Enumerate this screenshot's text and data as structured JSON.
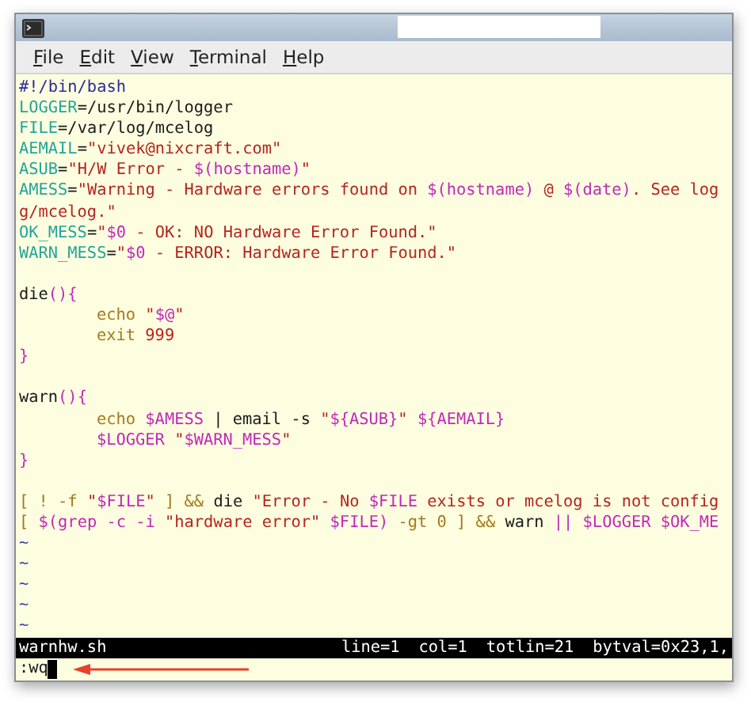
{
  "window": {
    "title_redacted": true
  },
  "menu": [
    {
      "label": "File"
    },
    {
      "label": "Edit"
    },
    {
      "label": "View"
    },
    {
      "label": "Terminal"
    },
    {
      "label": "Help"
    }
  ],
  "lines": [
    {
      "kind": "code",
      "segments": [
        {
          "text": "#!/bin/bash",
          "kind": "shebang"
        }
      ]
    },
    {
      "kind": "code",
      "segments": [
        {
          "text": "LOGGER",
          "kind": "var"
        },
        {
          "text": "=/usr/bin/logger",
          "kind": "plain"
        }
      ]
    },
    {
      "kind": "code",
      "segments": [
        {
          "text": "FILE",
          "kind": "var"
        },
        {
          "text": "=/var/log/mcelog",
          "kind": "plain"
        }
      ]
    },
    {
      "kind": "code",
      "segments": [
        {
          "text": "AEMAIL",
          "kind": "var"
        },
        {
          "text": "=",
          "kind": "plain"
        },
        {
          "text": "\"vivek@nixcraft.com\"",
          "kind": "str"
        }
      ]
    },
    {
      "kind": "code",
      "segments": [
        {
          "text": "ASUB",
          "kind": "var"
        },
        {
          "text": "=",
          "kind": "plain"
        },
        {
          "text": "\"H/W Error - ",
          "kind": "str"
        },
        {
          "text": "$(hostname)",
          "kind": "subst"
        },
        {
          "text": "\"",
          "kind": "str"
        }
      ]
    },
    {
      "kind": "code",
      "segments": [
        {
          "text": "AMESS",
          "kind": "var"
        },
        {
          "text": "=",
          "kind": "plain"
        },
        {
          "text": "\"Warning - Hardware errors found on ",
          "kind": "str"
        },
        {
          "text": "$(hostname)",
          "kind": "subst"
        },
        {
          "text": " @ ",
          "kind": "str"
        },
        {
          "text": "$(date)",
          "kind": "subst"
        },
        {
          "text": ". See log",
          "kind": "str"
        }
      ]
    },
    {
      "kind": "code",
      "segments": [
        {
          "text": "g/mcelog.\"",
          "kind": "str"
        }
      ]
    },
    {
      "kind": "code",
      "segments": [
        {
          "text": "OK_MESS",
          "kind": "var"
        },
        {
          "text": "=",
          "kind": "plain"
        },
        {
          "text": "\"",
          "kind": "str"
        },
        {
          "text": "$0",
          "kind": "subst"
        },
        {
          "text": " - OK: NO Hardware Error Found.\"",
          "kind": "str"
        }
      ]
    },
    {
      "kind": "code",
      "segments": [
        {
          "text": "WARN_MESS",
          "kind": "var"
        },
        {
          "text": "=",
          "kind": "plain"
        },
        {
          "text": "\"",
          "kind": "str"
        },
        {
          "text": "$0",
          "kind": "subst"
        },
        {
          "text": " - ERROR: Hardware Error Found.\"",
          "kind": "str"
        }
      ]
    },
    {
      "kind": "blank"
    },
    {
      "kind": "code",
      "segments": [
        {
          "text": "die",
          "kind": "plain"
        },
        {
          "text": "(){",
          "kind": "punct"
        }
      ]
    },
    {
      "kind": "code",
      "indent": true,
      "segments": [
        {
          "text": "echo ",
          "kind": "builtin"
        },
        {
          "text": "\"",
          "kind": "str"
        },
        {
          "text": "$@",
          "kind": "subst"
        },
        {
          "text": "\"",
          "kind": "str"
        }
      ]
    },
    {
      "kind": "code",
      "indent": true,
      "segments": [
        {
          "text": "exit ",
          "kind": "builtin"
        },
        {
          "text": "999",
          "kind": "num"
        }
      ]
    },
    {
      "kind": "code",
      "segments": [
        {
          "text": "}",
          "kind": "punct"
        }
      ]
    },
    {
      "kind": "blank"
    },
    {
      "kind": "code",
      "segments": [
        {
          "text": "warn",
          "kind": "plain"
        },
        {
          "text": "(){",
          "kind": "punct"
        }
      ]
    },
    {
      "kind": "code",
      "indent": true,
      "segments": [
        {
          "text": "echo ",
          "kind": "builtin"
        },
        {
          "text": "$AMESS",
          "kind": "subst"
        },
        {
          "text": " | email -s ",
          "kind": "plain"
        },
        {
          "text": "\"",
          "kind": "str"
        },
        {
          "text": "${ASUB}",
          "kind": "subst"
        },
        {
          "text": "\" ",
          "kind": "str"
        },
        {
          "text": "${AEMAIL}",
          "kind": "subst"
        }
      ]
    },
    {
      "kind": "code",
      "indent": true,
      "segments": [
        {
          "text": "$LOGGER ",
          "kind": "subst"
        },
        {
          "text": "\"",
          "kind": "str"
        },
        {
          "text": "$WARN_MESS",
          "kind": "subst"
        },
        {
          "text": "\"",
          "kind": "str"
        }
      ]
    },
    {
      "kind": "code",
      "segments": [
        {
          "text": "}",
          "kind": "punct"
        }
      ]
    },
    {
      "kind": "blank"
    },
    {
      "kind": "code",
      "segments": [
        {
          "text": "[ ! -f ",
          "kind": "builtin"
        },
        {
          "text": "\"",
          "kind": "str"
        },
        {
          "text": "$FILE",
          "kind": "subst"
        },
        {
          "text": "\"",
          "kind": "str"
        },
        {
          "text": " ] && ",
          "kind": "builtin"
        },
        {
          "text": "die ",
          "kind": "plain"
        },
        {
          "text": "\"Error - No ",
          "kind": "str"
        },
        {
          "text": "$FILE",
          "kind": "subst"
        },
        {
          "text": " exists or mcelog is not config",
          "kind": "str"
        }
      ]
    },
    {
      "kind": "code",
      "segments": [
        {
          "text": "[ ",
          "kind": "builtin"
        },
        {
          "text": "$(grep -c -i ",
          "kind": "subst"
        },
        {
          "text": "\"hardware error\" ",
          "kind": "str"
        },
        {
          "text": "$FILE",
          "kind": "subst"
        },
        {
          "text": ")",
          "kind": "subst"
        },
        {
          "text": " -gt 0 ] && ",
          "kind": "builtin"
        },
        {
          "text": "warn ",
          "kind": "plain"
        },
        {
          "text": "|| ",
          "kind": "subst"
        },
        {
          "text": "$LOGGER ",
          "kind": "subst"
        },
        {
          "text": "$OK_ME",
          "kind": "subst"
        }
      ]
    }
  ],
  "tilde_lines": [
    "~",
    "~",
    "~",
    "~",
    "~"
  ],
  "status_bar": {
    "filename": "warnhw.sh",
    "fields": [
      "line=1",
      "col=1",
      "totlin=21",
      "bytval=0x23,1,"
    ]
  },
  "command_line": {
    "text": ":wq",
    "cursor": true,
    "arrow": true
  }
}
